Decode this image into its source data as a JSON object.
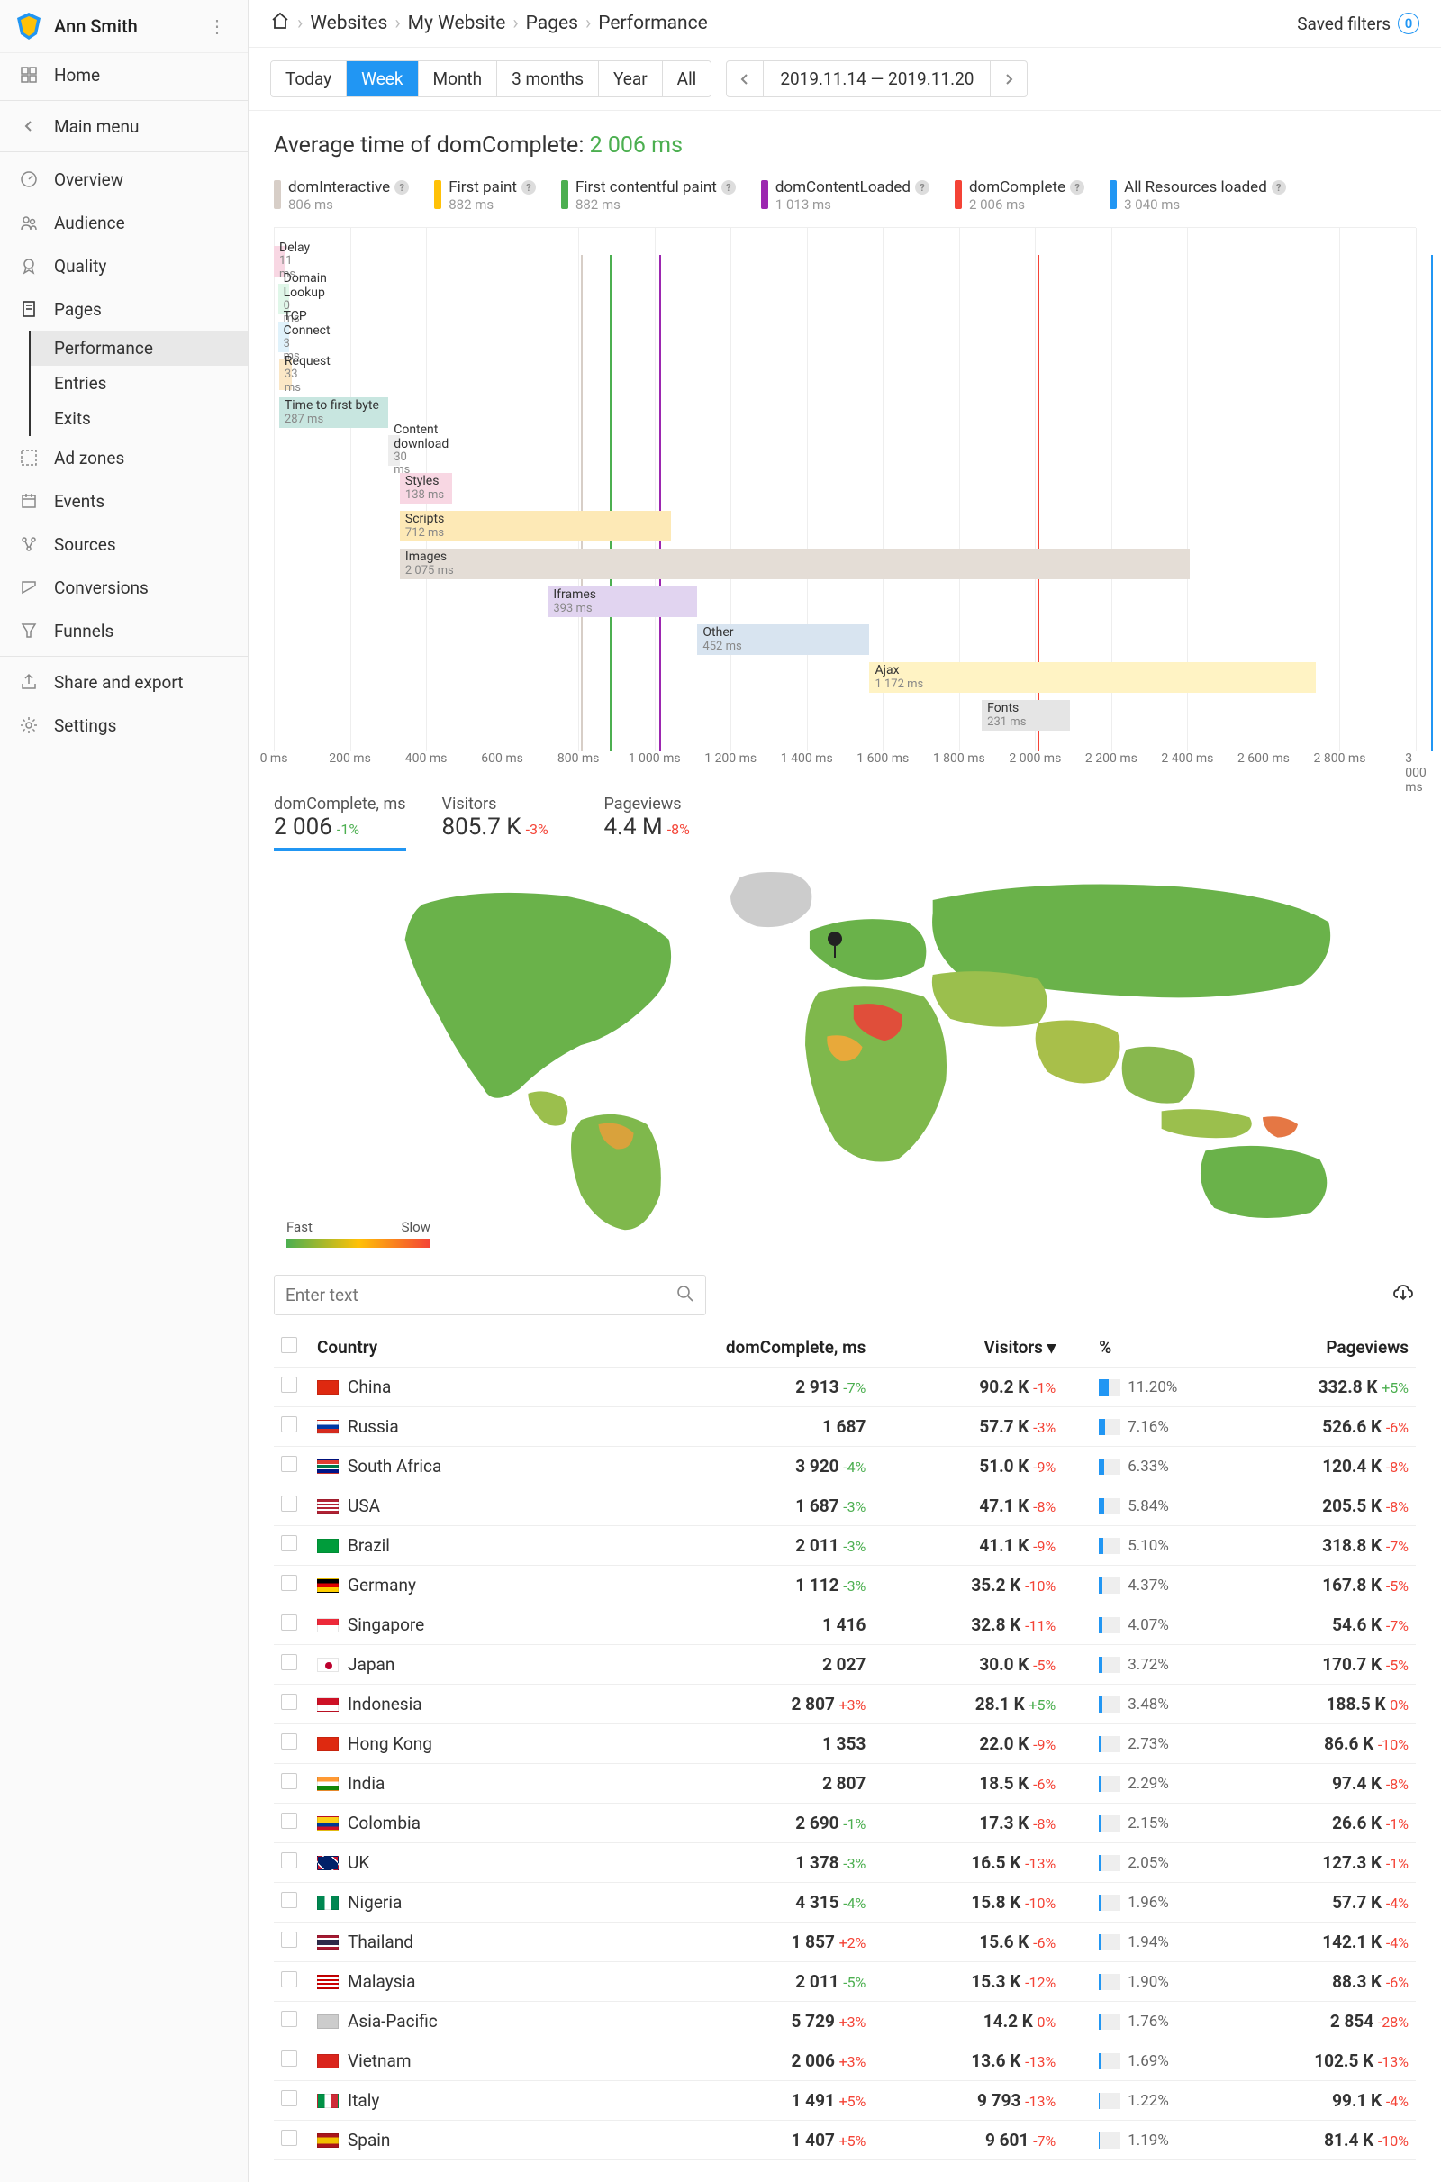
{
  "user": {
    "name": "Ann Smith"
  },
  "nav": {
    "home": "Home",
    "main_menu": "Main menu",
    "items": [
      {
        "id": "overview",
        "label": "Overview"
      },
      {
        "id": "audience",
        "label": "Audience"
      },
      {
        "id": "quality",
        "label": "Quality"
      },
      {
        "id": "pages",
        "label": "Pages",
        "sub": [
          "Performance",
          "Entries",
          "Exits"
        ],
        "active_sub": 0
      },
      {
        "id": "adzones",
        "label": "Ad zones"
      },
      {
        "id": "events",
        "label": "Events"
      },
      {
        "id": "sources",
        "label": "Sources"
      },
      {
        "id": "conversions",
        "label": "Conversions"
      },
      {
        "id": "funnels",
        "label": "Funnels"
      }
    ],
    "share": "Share and export",
    "settings": "Settings"
  },
  "breadcrumb": [
    "Websites",
    "My Website",
    "Pages",
    "Performance"
  ],
  "saved_filters": {
    "label": "Saved filters",
    "count": "0"
  },
  "range_tabs": [
    "Today",
    "Week",
    "Month",
    "3 months",
    "Year",
    "All"
  ],
  "range_active": 1,
  "date_range": "2019.11.14 — 2019.11.20",
  "average": {
    "label": "Average time of domComplete:",
    "value": "2 006 ms"
  },
  "legend": [
    {
      "label": "domInteractive",
      "sub": "806 ms",
      "color": "#D7CEC7"
    },
    {
      "label": "First paint",
      "sub": "882 ms",
      "color": "#FFC107"
    },
    {
      "label": "First contentful paint",
      "sub": "882 ms",
      "color": "#4CAF50"
    },
    {
      "label": "domContentLoaded",
      "sub": "1 013 ms",
      "color": "#9C27B0"
    },
    {
      "label": "domComplete",
      "sub": "2 006 ms",
      "color": "#f44336"
    },
    {
      "label": "All Resources loaded",
      "sub": "3 040 ms",
      "color": "#2196F3"
    }
  ],
  "chart_data": {
    "type": "bar",
    "title": "Average time of domComplete",
    "xlabel": "ms",
    "xlim": [
      0,
      3000
    ],
    "ticks": [
      0,
      200,
      400,
      600,
      800,
      1000,
      1200,
      1400,
      1600,
      1800,
      2000,
      2200,
      2400,
      2600,
      2800,
      3000
    ],
    "markers": [
      {
        "label": "domInteractive",
        "ms": 806,
        "color": "#D7CEC7"
      },
      {
        "label": "First paint",
        "ms": 882,
        "color": "#FFC107"
      },
      {
        "label": "First contentful paint",
        "ms": 882,
        "color": "#4CAF50"
      },
      {
        "label": "domContentLoaded",
        "ms": 1013,
        "color": "#9C27B0"
      },
      {
        "label": "domComplete",
        "ms": 2006,
        "color": "#f44336"
      },
      {
        "label": "All Resources loaded",
        "ms": 3040,
        "color": "#2196F3"
      }
    ],
    "bars": [
      {
        "label": "Delay",
        "sub": "11 ms",
        "start": 0,
        "dur": 11,
        "color": "#F8D7E3"
      },
      {
        "label": "Domain Lookup",
        "sub": "0 ms",
        "start": 11,
        "dur": 0,
        "color": "#E0F7E9"
      },
      {
        "label": "TCP Connect",
        "sub": "3 ms",
        "start": 11,
        "dur": 3,
        "color": "#E0F2FB"
      },
      {
        "label": "Request",
        "sub": "33 ms",
        "start": 14,
        "dur": 33,
        "color": "#FBE7C6"
      },
      {
        "label": "Time to first byte",
        "sub": "287 ms",
        "start": 14,
        "dur": 287,
        "color": "#C8E6E0"
      },
      {
        "label": "Content download",
        "sub": "30 ms",
        "start": 301,
        "dur": 30,
        "color": "#EDEDED"
      },
      {
        "label": "Styles",
        "sub": "138 ms",
        "start": 331,
        "dur": 138,
        "color": "#F8D7E3"
      },
      {
        "label": "Scripts",
        "sub": "712 ms",
        "start": 331,
        "dur": 712,
        "color": "#FDE9B6"
      },
      {
        "label": "Images",
        "sub": "2 075 ms",
        "start": 331,
        "dur": 2075,
        "color": "#E4DDD6"
      },
      {
        "label": "Iframes",
        "sub": "393 ms",
        "start": 720,
        "dur": 393,
        "color": "#E1D4F0"
      },
      {
        "label": "Other",
        "sub": "452 ms",
        "start": 1113,
        "dur": 452,
        "color": "#D8E4F0"
      },
      {
        "label": "Ajax",
        "sub": "1 172 ms",
        "start": 1565,
        "dur": 1172,
        "color": "#FFF3C4"
      },
      {
        "label": "Fonts",
        "sub": "231 ms",
        "start": 1860,
        "dur": 231,
        "color": "#E5E5E5"
      }
    ]
  },
  "metrics": [
    {
      "title": "domComplete, ms",
      "value": "2 006",
      "delta": "-1%",
      "deltaSign": "pos",
      "active": true
    },
    {
      "title": "Visitors",
      "value": "805.7 K",
      "delta": "-3%",
      "deltaSign": "neg"
    },
    {
      "title": "Pageviews",
      "value": "4.4 M",
      "delta": "-8%",
      "deltaSign": "neg"
    }
  ],
  "map_legend": {
    "fast": "Fast",
    "slow": "Slow"
  },
  "search_placeholder": "Enter text",
  "columns": [
    "Country",
    "domComplete, ms",
    "Visitors",
    "%",
    "Pageviews"
  ],
  "sort_col": 2,
  "rows": [
    {
      "flag": "cn",
      "country": "China",
      "dom": "2 913",
      "domDelta": "-7%",
      "domSign": "pos",
      "vis": "90.2 K",
      "visDelta": "-1%",
      "visSign": "neg",
      "pct": 11.2,
      "pctTxt": "11.20%",
      "pv": "332.8 K",
      "pvDelta": "+5%",
      "pvSign": "pos"
    },
    {
      "flag": "ru",
      "country": "Russia",
      "dom": "1 687",
      "domDelta": "",
      "vis": "57.7 K",
      "visDelta": "-3%",
      "visSign": "neg",
      "pct": 7.16,
      "pctTxt": "7.16%",
      "pv": "526.6 K",
      "pvDelta": "-6%",
      "pvSign": "neg"
    },
    {
      "flag": "za",
      "country": "South Africa",
      "dom": "3 920",
      "domDelta": "-4%",
      "domSign": "pos",
      "vis": "51.0 K",
      "visDelta": "-9%",
      "visSign": "neg",
      "pct": 6.33,
      "pctTxt": "6.33%",
      "pv": "120.4 K",
      "pvDelta": "-8%",
      "pvSign": "neg"
    },
    {
      "flag": "us",
      "country": "USA",
      "dom": "1 687",
      "domDelta": "-3%",
      "domSign": "pos",
      "vis": "47.1 K",
      "visDelta": "-8%",
      "visSign": "neg",
      "pct": 5.84,
      "pctTxt": "5.84%",
      "pv": "205.5 K",
      "pvDelta": "-8%",
      "pvSign": "neg"
    },
    {
      "flag": "br",
      "country": "Brazil",
      "dom": "2 011",
      "domDelta": "-3%",
      "domSign": "pos",
      "vis": "41.1 K",
      "visDelta": "-9%",
      "visSign": "neg",
      "pct": 5.1,
      "pctTxt": "5.10%",
      "pv": "318.8 K",
      "pvDelta": "-7%",
      "pvSign": "neg"
    },
    {
      "flag": "de",
      "country": "Germany",
      "dom": "1 112",
      "domDelta": "-3%",
      "domSign": "pos",
      "vis": "35.2 K",
      "visDelta": "-10%",
      "visSign": "neg",
      "pct": 4.37,
      "pctTxt": "4.37%",
      "pv": "167.8 K",
      "pvDelta": "-5%",
      "pvSign": "neg"
    },
    {
      "flag": "sg",
      "country": "Singapore",
      "dom": "1 416",
      "domDelta": "",
      "vis": "32.8 K",
      "visDelta": "-11%",
      "visSign": "neg",
      "pct": 4.07,
      "pctTxt": "4.07%",
      "pv": "54.6 K",
      "pvDelta": "-7%",
      "pvSign": "neg"
    },
    {
      "flag": "jp",
      "country": "Japan",
      "dom": "2 027",
      "domDelta": "",
      "vis": "30.0 K",
      "visDelta": "-5%",
      "visSign": "neg",
      "pct": 3.72,
      "pctTxt": "3.72%",
      "pv": "170.7 K",
      "pvDelta": "-5%",
      "pvSign": "neg"
    },
    {
      "flag": "id",
      "country": "Indonesia",
      "dom": "2 807",
      "domDelta": "+3%",
      "domSign": "neg",
      "vis": "28.1 K",
      "visDelta": "+5%",
      "visSign": "pos",
      "pct": 3.48,
      "pctTxt": "3.48%",
      "pv": "188.5 K",
      "pvDelta": "0%",
      "pvSign": "neg"
    },
    {
      "flag": "hk",
      "country": "Hong Kong",
      "dom": "1 353",
      "domDelta": "",
      "vis": "22.0 K",
      "visDelta": "-9%",
      "visSign": "neg",
      "pct": 2.73,
      "pctTxt": "2.73%",
      "pv": "86.6 K",
      "pvDelta": "-10%",
      "pvSign": "neg"
    },
    {
      "flag": "in",
      "country": "India",
      "dom": "2 807",
      "domDelta": "",
      "vis": "18.5 K",
      "visDelta": "-6%",
      "visSign": "neg",
      "pct": 2.29,
      "pctTxt": "2.29%",
      "pv": "97.4 K",
      "pvDelta": "-8%",
      "pvSign": "neg"
    },
    {
      "flag": "co",
      "country": "Colombia",
      "dom": "2 690",
      "domDelta": "-1%",
      "domSign": "pos",
      "vis": "17.3 K",
      "visDelta": "-8%",
      "visSign": "neg",
      "pct": 2.15,
      "pctTxt": "2.15%",
      "pv": "26.6 K",
      "pvDelta": "-1%",
      "pvSign": "neg"
    },
    {
      "flag": "uk",
      "country": "UK",
      "dom": "1 378",
      "domDelta": "-3%",
      "domSign": "pos",
      "vis": "16.5 K",
      "visDelta": "-13%",
      "visSign": "neg",
      "pct": 2.05,
      "pctTxt": "2.05%",
      "pv": "127.3 K",
      "pvDelta": "-1%",
      "pvSign": "neg"
    },
    {
      "flag": "ng",
      "country": "Nigeria",
      "dom": "4 315",
      "domDelta": "-4%",
      "domSign": "pos",
      "vis": "15.8 K",
      "visDelta": "-10%",
      "visSign": "neg",
      "pct": 1.96,
      "pctTxt": "1.96%",
      "pv": "57.7 K",
      "pvDelta": "-4%",
      "pvSign": "neg"
    },
    {
      "flag": "th",
      "country": "Thailand",
      "dom": "1 857",
      "domDelta": "+2%",
      "domSign": "neg",
      "vis": "15.6 K",
      "visDelta": "-6%",
      "visSign": "neg",
      "pct": 1.94,
      "pctTxt": "1.94%",
      "pv": "142.1 K",
      "pvDelta": "-4%",
      "pvSign": "neg"
    },
    {
      "flag": "my",
      "country": "Malaysia",
      "dom": "2 011",
      "domDelta": "-5%",
      "domSign": "pos",
      "vis": "15.3 K",
      "visDelta": "-12%",
      "visSign": "neg",
      "pct": 1.9,
      "pctTxt": "1.90%",
      "pv": "88.3 K",
      "pvDelta": "-6%",
      "pvSign": "neg"
    },
    {
      "flag": "ap",
      "country": "Asia-Pacific",
      "dom": "5 729",
      "domDelta": "+3%",
      "domSign": "neg",
      "vis": "14.2 K",
      "visDelta": "0%",
      "visSign": "neg",
      "pct": 1.76,
      "pctTxt": "1.76%",
      "pv": "2 854",
      "pvDelta": "-28%",
      "pvSign": "neg"
    },
    {
      "flag": "vn",
      "country": "Vietnam",
      "dom": "2 006",
      "domDelta": "+3%",
      "domSign": "neg",
      "vis": "13.6 K",
      "visDelta": "-13%",
      "visSign": "neg",
      "pct": 1.69,
      "pctTxt": "1.69%",
      "pv": "102.5 K",
      "pvDelta": "-13%",
      "pvSign": "neg"
    },
    {
      "flag": "it",
      "country": "Italy",
      "dom": "1 491",
      "domDelta": "+5%",
      "domSign": "neg",
      "vis": "9 793",
      "visDelta": "-13%",
      "visSign": "neg",
      "pct": 1.22,
      "pctTxt": "1.22%",
      "pv": "99.1 K",
      "pvDelta": "-4%",
      "pvSign": "neg"
    },
    {
      "flag": "es",
      "country": "Spain",
      "dom": "1 407",
      "domDelta": "+5%",
      "domSign": "neg",
      "vis": "9 601",
      "visDelta": "-7%",
      "visSign": "neg",
      "pct": 1.19,
      "pctTxt": "1.19%",
      "pv": "81.4 K",
      "pvDelta": "-10%",
      "pvSign": "neg"
    }
  ]
}
